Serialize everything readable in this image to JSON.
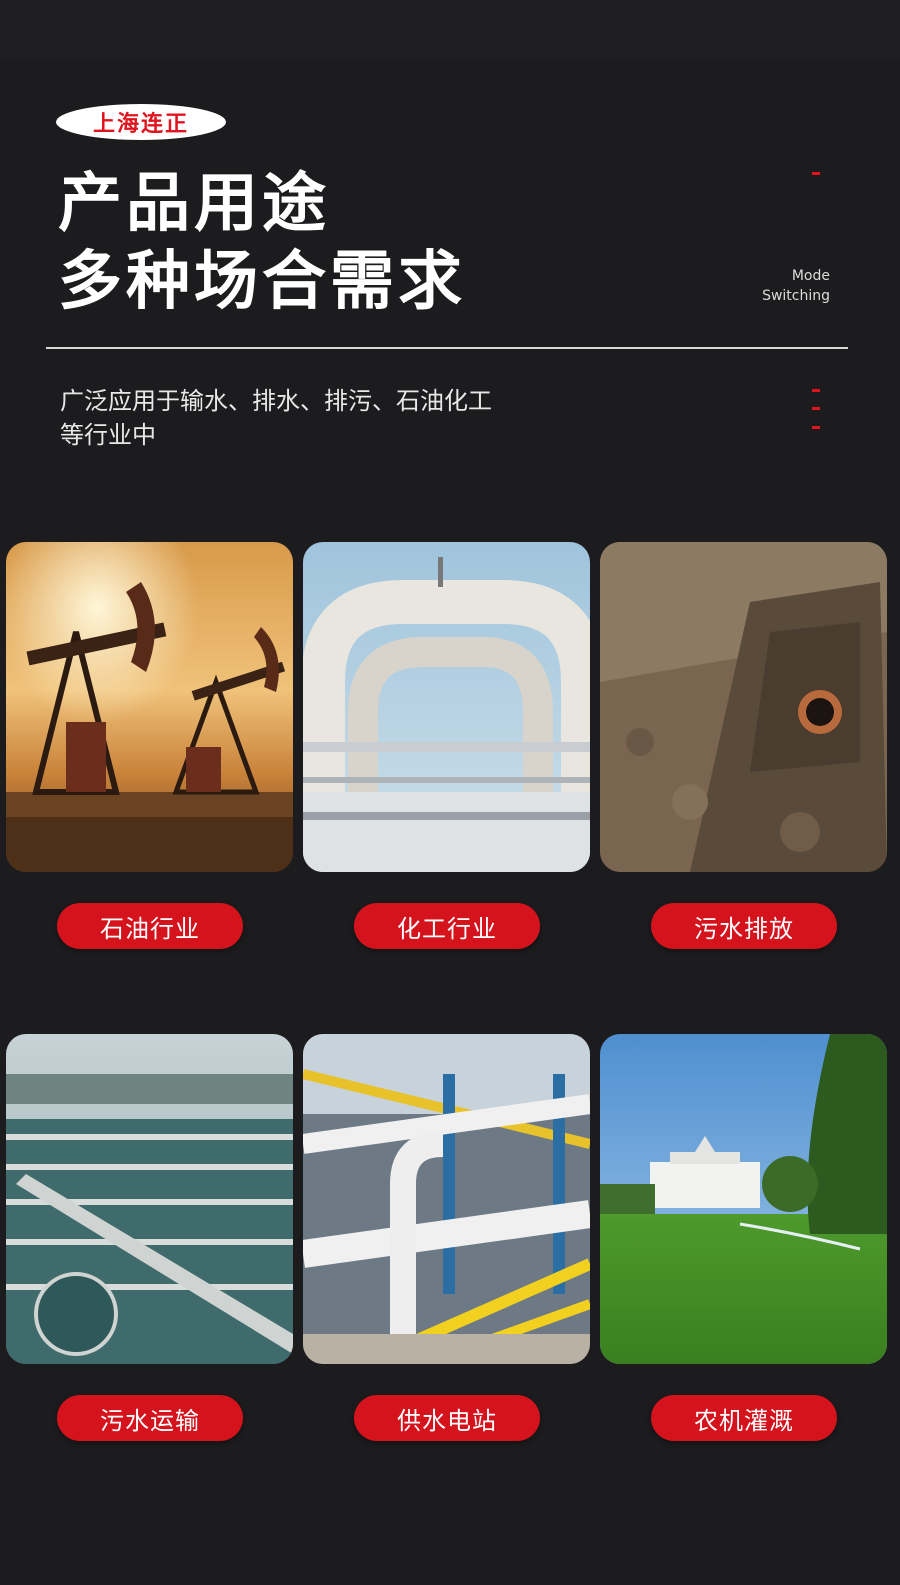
{
  "brand": {
    "logo_text": "上海连正"
  },
  "header": {
    "title_line1": "产品用途",
    "title_line2": "多种场合需求",
    "mode_line1": "Mode",
    "mode_line2": "Switching"
  },
  "description": {
    "line1": "广泛应用于输水、排水、排污、石油化工",
    "line2": "等行业中"
  },
  "applications": [
    {
      "label": "石油行业",
      "image": "oil-pumpjack-photo"
    },
    {
      "label": "化工行业",
      "image": "chemical-pipeline-photo"
    },
    {
      "label": "污水排放",
      "image": "sewage-trench-photo"
    },
    {
      "label": "污水运输",
      "image": "water-treatment-plant-photo"
    },
    {
      "label": "供水电站",
      "image": "water-station-pipes-photo"
    },
    {
      "label": "农机灌溉",
      "image": "lawn-sprinkler-photo"
    }
  ],
  "colors": {
    "background": "#1c1c1e",
    "accent": "#d4131d",
    "text": "#ffffff"
  }
}
